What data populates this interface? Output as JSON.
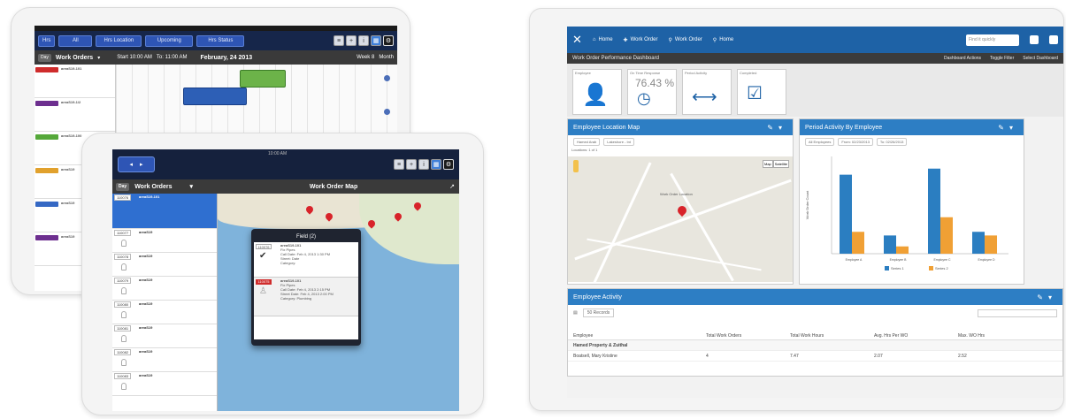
{
  "tablet_calendar": {
    "buttons": [
      "Hrs",
      "All",
      "Hrs Location",
      "Upcoming",
      "All",
      "Hrs Status"
    ],
    "header": {
      "left_button": "Day",
      "title": "Work Orders",
      "time_from": "Start 10:00 AM",
      "time_to": "To: 11:00 AM",
      "date": "February, 24 2013",
      "right_a": "Week 8",
      "right_b": "Month"
    },
    "rows": [
      {
        "id": "110076",
        "name": "areaS19-101",
        "color": "#cf2c2c"
      },
      {
        "id": "110077",
        "name": "areaS19-1/2",
        "color": "#6d2f8f"
      },
      {
        "id": "110078",
        "name": "areaS19-100",
        "color": "#55a83a"
      },
      {
        "id": "110079",
        "name": "areaS19",
        "color": "#e1a12d"
      },
      {
        "id": "110080",
        "name": "areaS19",
        "color": "#3568c4"
      },
      {
        "id": "110081",
        "name": "areaS19",
        "color": "#6d2f8f"
      }
    ]
  },
  "tablet_map": {
    "clock": "10:00 AM",
    "list_title": "Work Orders",
    "day_button": "Day",
    "map_title": "Work Order Map",
    "orders": [
      {
        "num": "110076",
        "name": "areaS19-101"
      },
      {
        "num": "110077",
        "name": "areaS19"
      },
      {
        "num": "110078",
        "name": "areaS19"
      },
      {
        "num": "110079",
        "name": "areaS19"
      },
      {
        "num": "110080",
        "name": "areaS19"
      },
      {
        "num": "110081",
        "name": "areaS19"
      },
      {
        "num": "110082",
        "name": "areaS19"
      },
      {
        "num": "110083",
        "name": "areaS19"
      }
    ],
    "popup": {
      "title": "Field (2)",
      "items": [
        {
          "badge": "110076",
          "name": "areaS19-101",
          "line1": "Fix Pipes",
          "line2": "Call Date:  Feb 4, 2013 1:30 PM",
          "line3": "Street: Date",
          "line4": "Category:"
        },
        {
          "badge": "110075",
          "name": "areaS19-101",
          "line1": "Fix Pipes",
          "line2": "Call Date:  Feb 4, 2013 2:15 PM",
          "line3": "Street Date: Feb 4, 2013 2:00 PM",
          "line4": "Category: Plumbing"
        }
      ]
    }
  },
  "dashboard": {
    "nav": [
      "Home",
      "Work Order",
      "Work Order",
      "Home"
    ],
    "search_placeholder": "Find it quickly",
    "title": "Work Order Performance Dashboard",
    "actions": [
      "Dashboard Actions",
      "Toggle Filter",
      "Select Dashboard"
    ],
    "tiles": [
      {
        "label": "Employee"
      },
      {
        "label": "On Time Response",
        "value": "76.43 %"
      },
      {
        "label": "Period Activity"
      },
      {
        "label": "Completed"
      }
    ],
    "map_panel": {
      "title": "Employee Location Map",
      "filter1": "Hamed Arab",
      "filter2": "Lakeshore - Int",
      "label": "Locations: 1 of 1",
      "map_btn": "Map",
      "sat_btn": "Satellite",
      "pin_label": "Work Order Location"
    },
    "chart_panel": {
      "title": "Period Activity By Employee",
      "filter1": "All Employees",
      "filter2": "From: 02/23/2013",
      "filter3": "To: 02/26/2013"
    },
    "activity_panel": {
      "title": "Employee Activity",
      "page_size": "50 Records",
      "columns": [
        "Employee",
        "Total Work Orders",
        "Total Work Hours",
        "Avg. Hrs Per WO",
        "Max. WO Hrs"
      ],
      "group": "Hamed Property & Zuithal",
      "row": [
        "Boatsell, Mary Kristine",
        "4",
        "7.47",
        "2.07",
        "2.52"
      ]
    }
  },
  "chart_data": {
    "type": "bar",
    "title": "",
    "ylabel": "Work Order Count",
    "ylim": [
      0,
      8
    ],
    "categories": [
      "Employee A",
      "Employee B",
      "Employee C",
      "Employee D"
    ],
    "series": [
      {
        "name": "Series 1",
        "values": [
          6.5,
          1.5,
          7.0,
          1.8
        ],
        "color": "#2b7ec1"
      },
      {
        "name": "Series 2",
        "values": [
          1.8,
          0.6,
          3.0,
          1.5
        ],
        "color": "#f0a035"
      }
    ],
    "legend": "bottom"
  }
}
